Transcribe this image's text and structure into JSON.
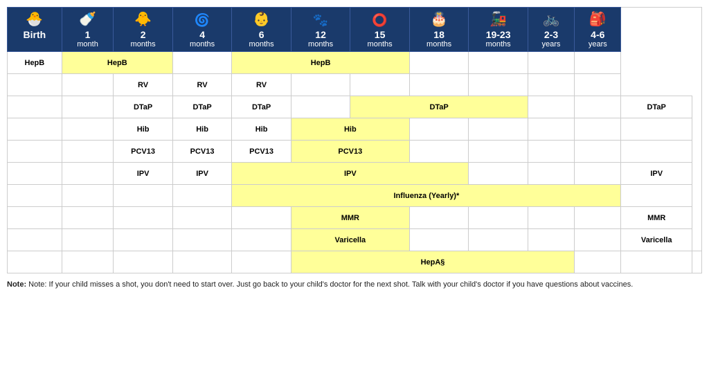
{
  "headers": [
    {
      "id": "birth",
      "icon": "🐣",
      "line1": "Birth",
      "line2": ""
    },
    {
      "id": "1m",
      "icon": "🍼",
      "line1": "1",
      "line2": "month"
    },
    {
      "id": "2m",
      "icon": "🐥",
      "line1": "2",
      "line2": "months"
    },
    {
      "id": "4m",
      "icon": "🌀",
      "line1": "4",
      "line2": "months"
    },
    {
      "id": "6m",
      "icon": "👶",
      "line1": "6",
      "line2": "months"
    },
    {
      "id": "12m",
      "icon": "🐾",
      "line1": "12",
      "line2": "months"
    },
    {
      "id": "15m",
      "icon": "🟡",
      "line1": "15",
      "line2": "months"
    },
    {
      "id": "18m",
      "icon": "🎂",
      "line1": "18",
      "line2": "months"
    },
    {
      "id": "19-23m",
      "icon": "🚂",
      "line1": "19-23",
      "line2": "months"
    },
    {
      "id": "2-3y",
      "icon": "🚲",
      "line1": "2-3",
      "line2": "years"
    },
    {
      "id": "4-6y",
      "icon": "🎒",
      "line1": "4-6",
      "line2": "years"
    }
  ],
  "rows": [
    {
      "label": "HepB",
      "cells": [
        {
          "id": "birth",
          "text": "",
          "style": ""
        },
        {
          "id": "1m",
          "text": "HepB",
          "style": "yellow",
          "colspan": 2
        },
        {
          "id": "2m",
          "skip": true
        },
        {
          "id": "4m",
          "text": "",
          "style": ""
        },
        {
          "id": "6m",
          "text": "HepB",
          "style": "yellow",
          "colspan": 3
        },
        {
          "id": "12m",
          "skip": true
        },
        {
          "id": "15m",
          "skip": true
        },
        {
          "id": "18m",
          "text": "",
          "style": ""
        },
        {
          "id": "19-23m",
          "text": "",
          "style": ""
        },
        {
          "id": "2-3y",
          "text": "",
          "style": ""
        },
        {
          "id": "4-6y",
          "text": "",
          "style": ""
        }
      ]
    }
  ],
  "note": "Note: If your child misses a shot, you don't need to start over. Just go back to your child's doctor for the next shot. Talk with your child's doctor if you have questions about vaccines."
}
